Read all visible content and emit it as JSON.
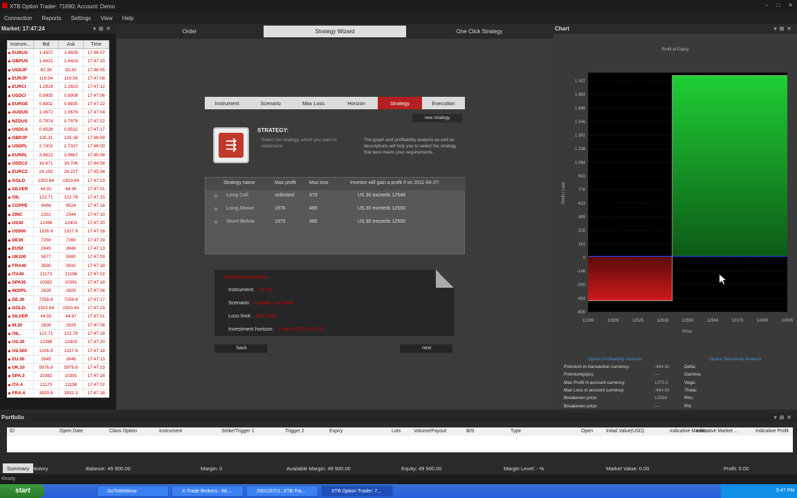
{
  "window": {
    "title": "XTB Option Trader: 71690; Account: Demo"
  },
  "menu": [
    "Connection",
    "Reports",
    "Settings",
    "View",
    "Help"
  ],
  "market": {
    "title": "Market: 17:47:24",
    "headers": [
      "Instrum...",
      "Bid",
      "Ask",
      "Time"
    ],
    "rows": [
      [
        "EURUS",
        "1.4507",
        "1.4509",
        "17:46:37"
      ],
      [
        "GBPUS",
        "1.6421",
        "1.6424",
        "17:47:15"
      ],
      [
        "USDJP",
        "82.39",
        "82.42",
        "17:46:55"
      ],
      [
        "EURJP",
        "119.54",
        "119.58",
        "17:47:08"
      ],
      [
        "EURCI",
        "1.2919",
        "1.2923",
        "17:47:12"
      ],
      [
        "USDCI",
        "0.8905",
        "0.8908",
        "17:47:06"
      ],
      [
        "EURGE",
        "0.8832",
        "0.8835",
        "17:47:22"
      ],
      [
        "AUDUS",
        "1.0672",
        "1.0676",
        "17:47:04"
      ],
      [
        "NZDUS",
        "0.7974",
        "0.7979",
        "17:47:22"
      ],
      [
        "USDCA",
        "0.9528",
        "0.9532",
        "17:47:17"
      ],
      [
        "GBPJP",
        "135.31",
        "135.38",
        "17:46:59"
      ],
      [
        "USDPL",
        "2.7302",
        "2.7337",
        "17:46:00"
      ],
      [
        "EURPL",
        "3.9622",
        "3.9667",
        "17:45:09"
      ],
      [
        "USDC2",
        "16.671",
        "16.706",
        "17:44:58"
      ],
      [
        "EURCZ",
        "24.192",
        "24.227",
        "17:45:34"
      ],
      [
        "GOLD",
        "1502.84",
        "1503.64",
        "17:47:23"
      ],
      [
        "SILVER",
        "44.91",
        "44.96",
        "17:47:01"
      ],
      [
        "OIL",
        "122.71",
        "122.78",
        "17:47:15"
      ],
      [
        "COPPE",
        "9494",
        "9524",
        "17:47:18"
      ],
      [
        "ZINC",
        "2331",
        "2344",
        "17:47:10"
      ],
      [
        "US30",
        "12398",
        "12403",
        "17:47:20"
      ],
      [
        "US500",
        "1326.9",
        "1327.9",
        "17:47:18"
      ],
      [
        "DE30",
        "7259",
        "7260",
        "17:47:19"
      ],
      [
        "EU50",
        "2845",
        "2848",
        "17:47:13"
      ],
      [
        "UK100",
        "5977",
        "5980",
        "17:47:03"
      ],
      [
        "FRA40",
        "3930",
        "3932",
        "17:47:18"
      ],
      [
        "ITA40",
        "21173",
        "21198",
        "17:47:02"
      ],
      [
        "SPA35",
        "10382",
        "10391",
        "17:47:18"
      ],
      [
        "W20PL",
        "2926",
        "2929",
        "17:47:08"
      ],
      [
        "DE.30",
        "7258.8",
        "7259.8",
        "17:47:17"
      ],
      [
        "GOLD.",
        "1502.84",
        "1503.64",
        "17:47:23"
      ],
      [
        "SILVER",
        "44.92",
        "44.97",
        "17:47:01"
      ],
      [
        "W.20",
        "2926",
        "2929",
        "17:47:08"
      ],
      [
        "OIL.",
        "122.71",
        "122.78",
        "17:47:18"
      ],
      [
        "US.30",
        "12398",
        "12403",
        "17:47:20"
      ],
      [
        "US.500",
        "1326.9",
        "1327.9",
        "17:47:18"
      ],
      [
        "EU.50",
        "2845",
        "2848",
        "17:47:13"
      ],
      [
        "UK.10",
        "5976.8",
        "5979.8",
        "17:47:23"
      ],
      [
        "SPA.3",
        "10382",
        "10391",
        "17:47:18"
      ],
      [
        "ITA.4",
        "21173",
        "21198",
        "17:47:02"
      ],
      [
        "FRA.4",
        "3929.8",
        "3932.3",
        "17:47:18"
      ]
    ]
  },
  "center": {
    "tabs": [
      "Order",
      "Strategy Wizard",
      "One Click Strategy"
    ],
    "steps": [
      "Instrument",
      "Scenario",
      "Max Loss",
      "Horizon",
      "Strategy",
      "Execution"
    ],
    "new_strategy": "new strategy",
    "strategy_title": "STRATEGY:",
    "desc_left": "Select the strategy, which you want to implement",
    "desc_right": "The graph and profitability analysis as well as descriptions will help you to select the strategy that best meets your requirements.",
    "table_headers": [
      "Strategy name",
      "Max profit",
      "Max loss",
      "Investor will gain a profit if on 2011-04-27:"
    ],
    "strategies": [
      [
        "Long Call",
        "unlimited",
        "479",
        "US.30 exceeds 12548"
      ],
      [
        "Long Above",
        "1976",
        "485",
        "US.30 exceeds 12550"
      ],
      [
        "Short Below",
        "1975",
        "485",
        "US.30 exceeds 12550"
      ]
    ],
    "params_header": "Selected parameters",
    "params": [
      {
        "label": "Instrument:",
        "value": "US.30"
      },
      {
        "label": "Scenario:",
        "value": "Upside, not clear"
      },
      {
        "label": "Loss limit:",
        "value": "500 USD"
      },
      {
        "label": "Investment horizon:",
        "value": "1 days (2011-04-27)"
      }
    ],
    "back": "back",
    "next": "next"
  },
  "chart": {
    "panel_title": "Chart",
    "title": "Profit at Expiry",
    "ylabel": "Profit / Loss",
    "xlabel": "Price",
    "yticks": [
      "1 007",
      "1 883",
      "1 699",
      "1 546",
      "1 392",
      "1 238",
      "1 084",
      "933",
      "776",
      "623",
      "469",
      "315",
      "161",
      "0",
      "-146",
      "-300",
      "-454",
      "-608"
    ],
    "xticks": [
      "11299",
      "12609",
      "12525",
      "12616",
      "12550",
      "12564",
      "12178",
      "12493",
      "12606"
    ],
    "colors": {
      "profit": "#1fae2e",
      "loss": "#c4161c",
      "bg": "#000000"
    },
    "analysis_left_title": "Option Profitability Analysis",
    "analysis_right_title": "Option Sensitivity Analysis",
    "analysis": [
      {
        "label": "Premium in transaction currency:",
        "value": "-484.82"
      },
      {
        "label": "Premium(pips):",
        "value": "----"
      },
      {
        "label": "Max Profit in account currency:",
        "value": "1375.5"
      },
      {
        "label": "Max Loss in account currency:",
        "value": "-484.82"
      },
      {
        "label": "Breakeven price:",
        "value": "12550"
      },
      {
        "label": "Breakeven price:",
        "value": "----"
      }
    ],
    "greeks": [
      "Delta:",
      "Gamma:",
      "Vega:",
      "Theta:",
      "Rho:",
      "Phi:"
    ]
  },
  "chart_data": {
    "type": "area",
    "title": "Profit at Expiry",
    "xlabel": "Price",
    "ylabel": "Profit / Loss",
    "x": [
      12509,
      12550,
      12550,
      12606
    ],
    "y": [
      -485,
      -485,
      1976,
      1976
    ],
    "ylim": [
      -608,
      2007
    ]
  },
  "portfolio": {
    "title": "Portfolio",
    "headers": [
      "ID",
      "Open Date",
      "Class Option",
      "Instrument",
      "Strike/Trigger 1",
      "Trigger 2",
      "Expiry",
      "Lots",
      "Volume/Payout",
      "B/S",
      "Type",
      "Open",
      "Initial Value(USD)",
      "Indicative Market ...",
      "Indicative Market ...",
      "Indicative Profit"
    ],
    "tabs": [
      "Summary",
      "History"
    ],
    "footer": {
      "balance": "Balance: 49 900.00",
      "margin": "Margin: 0",
      "available": "Available Margin: 49 900.00",
      "equity": "Equity: 49 900.00",
      "margin_level": "Margin Level: - %",
      "market_value": "Market Value: 0.00",
      "profit": "Profit: 0.00"
    }
  },
  "status": "Ready",
  "taskbar": {
    "start": "start",
    "items": [
      "GoToWebinar",
      "X-Trade Brokers - Wi...",
      "290116721: XTB-Tra...",
      "XTB Option Trader: 7..."
    ],
    "clock": "5:47 PM"
  }
}
